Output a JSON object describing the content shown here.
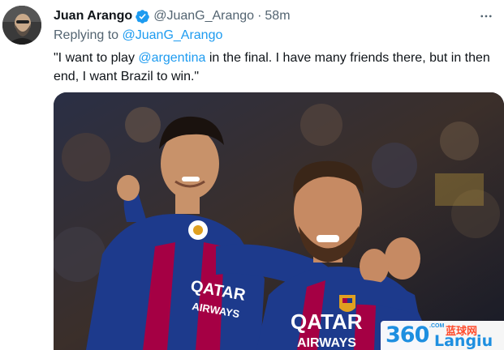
{
  "tweet": {
    "display_name": "Juan Arango",
    "handle": "@JuanG_Arango",
    "separator": "·",
    "time": "58m",
    "verified": true,
    "replying_prefix": "Replying to ",
    "replying_handle": "@JuanG_Arango",
    "text_before_mention": "\"I want to play ",
    "mention": "@argentina",
    "text_after_mention": " in the final.  I have many friends there, but in then end, I want Brazil to win.\"",
    "more_icon": "more-horizontal-icon",
    "verified_icon": "verified-badge-icon"
  },
  "media": {
    "description_icon": "photo",
    "jersey_text_left": "QATAR AIRWAYS",
    "jersey_text_right": "QATAR AIRWAYS",
    "watermark": {
      "number": "360",
      "domain_suffix": ".COM",
      "chinese": "蓝球网",
      "english": "Langiu"
    }
  },
  "colors": {
    "link": "#1d9bf0",
    "secondary_text": "#536471",
    "primary_text": "#0f1419",
    "verified": "#1d9bf0",
    "jersey_blue": "#1d3a8c",
    "jersey_red": "#a50044"
  }
}
